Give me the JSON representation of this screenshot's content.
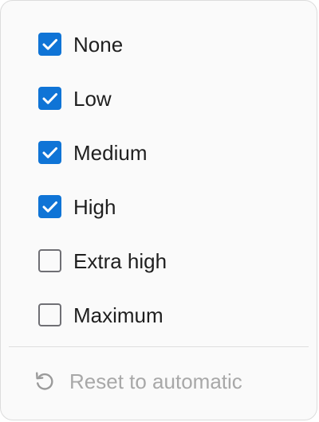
{
  "options": [
    {
      "label": "None",
      "checked": true
    },
    {
      "label": "Low",
      "checked": true
    },
    {
      "label": "Medium",
      "checked": true
    },
    {
      "label": "High",
      "checked": true
    },
    {
      "label": "Extra high",
      "checked": false
    },
    {
      "label": "Maximum",
      "checked": false
    }
  ],
  "reset": {
    "label": "Reset to automatic",
    "icon": "reset-icon",
    "disabled": true
  },
  "colors": {
    "accent": "#0f74d6",
    "checkbox_border": "#6f6f74",
    "text": "#1f1f1f",
    "disabled_text": "#a8a8a8",
    "panel_bg": "#fafafa"
  }
}
